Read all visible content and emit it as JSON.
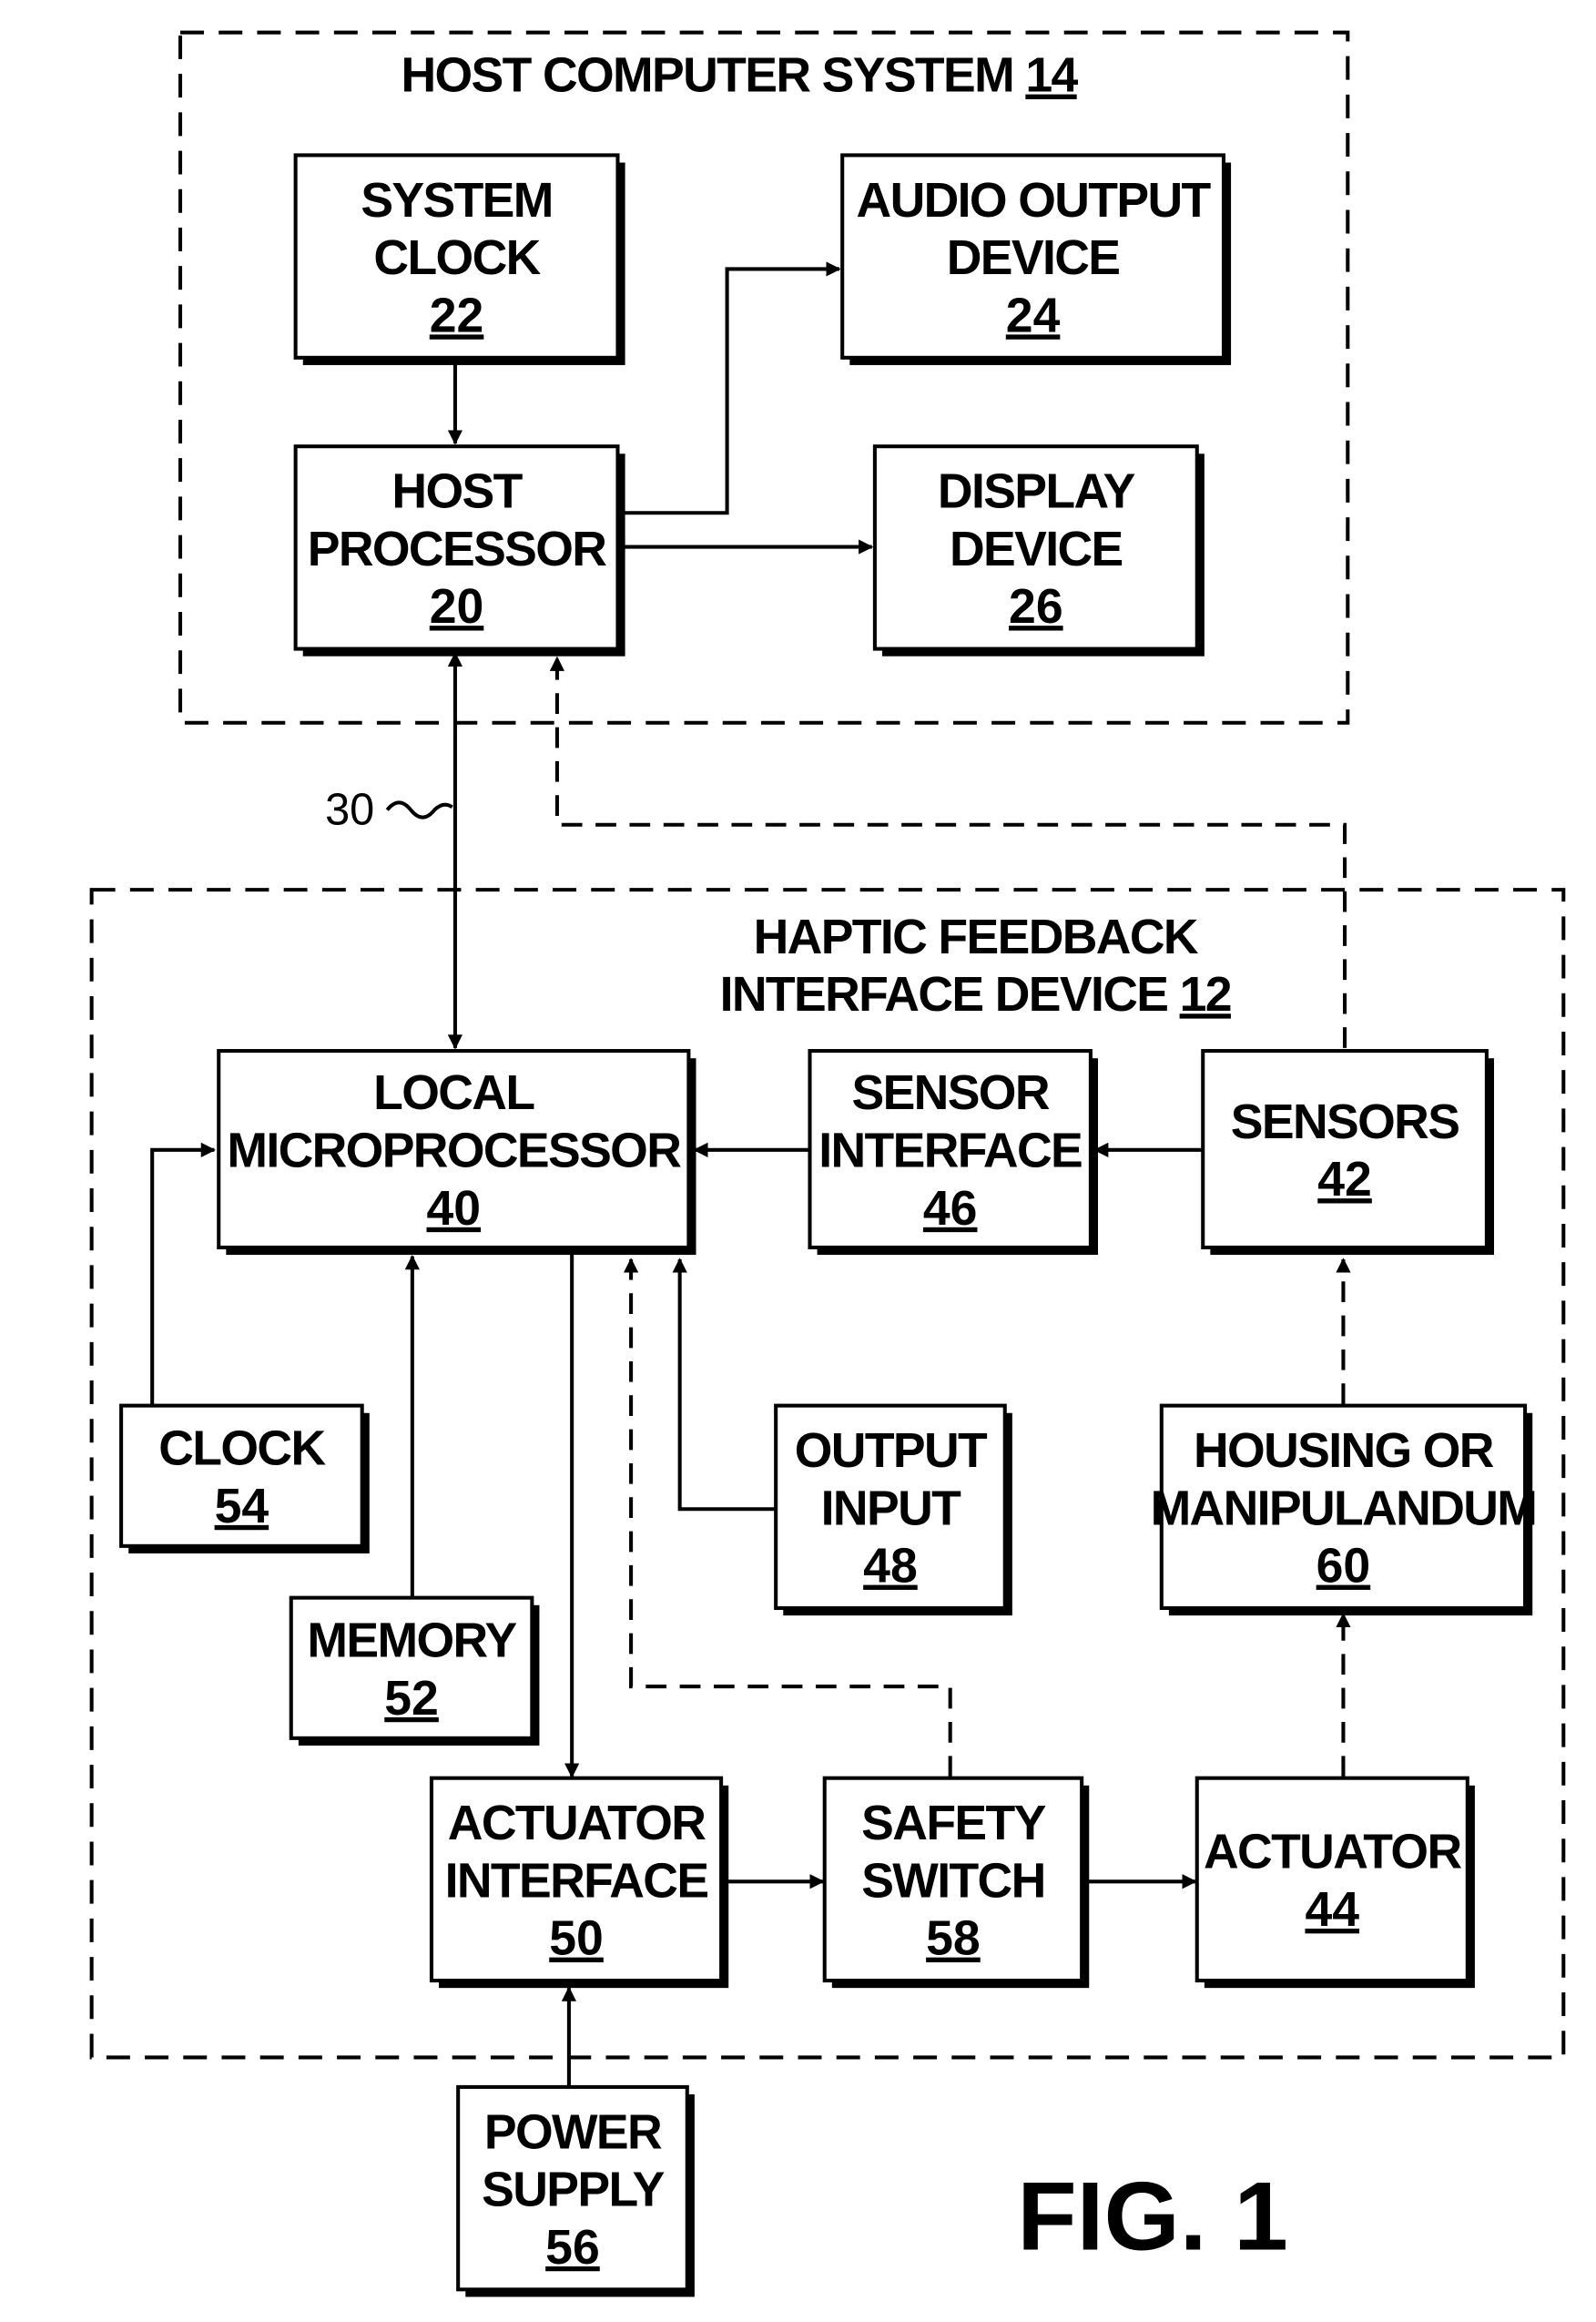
{
  "figure_label": "FIG. 1",
  "groups": {
    "host": {
      "title": "HOST COMPUTER SYSTEM",
      "ref": "14"
    },
    "haptic": {
      "title_line1": "HAPTIC FEEDBACK",
      "title_line2": "INTERFACE DEVICE",
      "ref": "12"
    }
  },
  "bus_label": "30",
  "blocks": {
    "system_clock": {
      "lines": [
        "SYSTEM",
        "CLOCK"
      ],
      "ref": "22"
    },
    "host_processor": {
      "lines": [
        "HOST",
        "PROCESSOR"
      ],
      "ref": "20"
    },
    "audio_output": {
      "lines": [
        "AUDIO OUTPUT",
        "DEVICE"
      ],
      "ref": "24"
    },
    "display_device": {
      "lines": [
        "DISPLAY",
        "DEVICE"
      ],
      "ref": "26"
    },
    "local_microprocessor": {
      "lines": [
        "LOCAL",
        "MICROPROCESSOR"
      ],
      "ref": "40"
    },
    "sensor_interface": {
      "lines": [
        "SENSOR",
        "INTERFACE"
      ],
      "ref": "46"
    },
    "sensors": {
      "lines": [
        "SENSORS"
      ],
      "ref": "42"
    },
    "clock": {
      "lines": [
        "CLOCK"
      ],
      "ref": "54"
    },
    "memory": {
      "lines": [
        "MEMORY"
      ],
      "ref": "52"
    },
    "output_input": {
      "lines": [
        "OUTPUT",
        "INPUT"
      ],
      "ref": "48"
    },
    "housing": {
      "lines": [
        "HOUSING OR",
        "MANIPULANDUM"
      ],
      "ref": "60"
    },
    "actuator_interface": {
      "lines": [
        "ACTUATOR",
        "INTERFACE"
      ],
      "ref": "50"
    },
    "safety_switch": {
      "lines": [
        "SAFETY",
        "SWITCH"
      ],
      "ref": "58"
    },
    "actuator": {
      "lines": [
        "ACTUATOR"
      ],
      "ref": "44"
    },
    "power_supply": {
      "lines": [
        "POWER",
        "SUPPLY"
      ],
      "ref": "56"
    }
  }
}
